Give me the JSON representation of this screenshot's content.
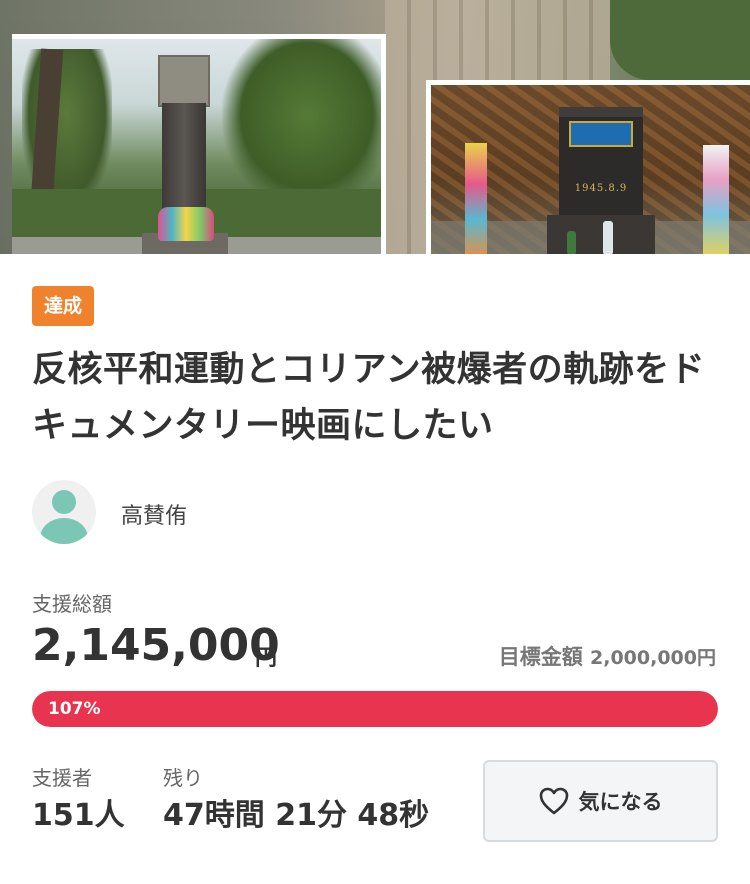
{
  "hero": {
    "photo2_date": "1945.8.9"
  },
  "project": {
    "status_badge": "達成",
    "title": "反核平和運動とコリアン被爆者の軌跡をドキュメンタリー映画にしたい",
    "owner_name": "高賛侑"
  },
  "funding": {
    "total_label": "支援総額",
    "total_amount": "2,145,000",
    "total_unit": "円",
    "goal_label": "目標金額",
    "goal_amount": "2,000,000円",
    "progress_text": "107%",
    "progress_percent": 107
  },
  "stats": {
    "supporters_label": "支援者",
    "supporters_value": "151人",
    "remaining_label": "残り",
    "remaining_value": "47時間 21分 48秒"
  },
  "actions": {
    "favorite_label": "気になる",
    "favorite_icon": "heart-outline-icon"
  },
  "colors": {
    "badge": "#f0822e",
    "progress": "#e8344e",
    "avatar": "#7cc6b6"
  }
}
